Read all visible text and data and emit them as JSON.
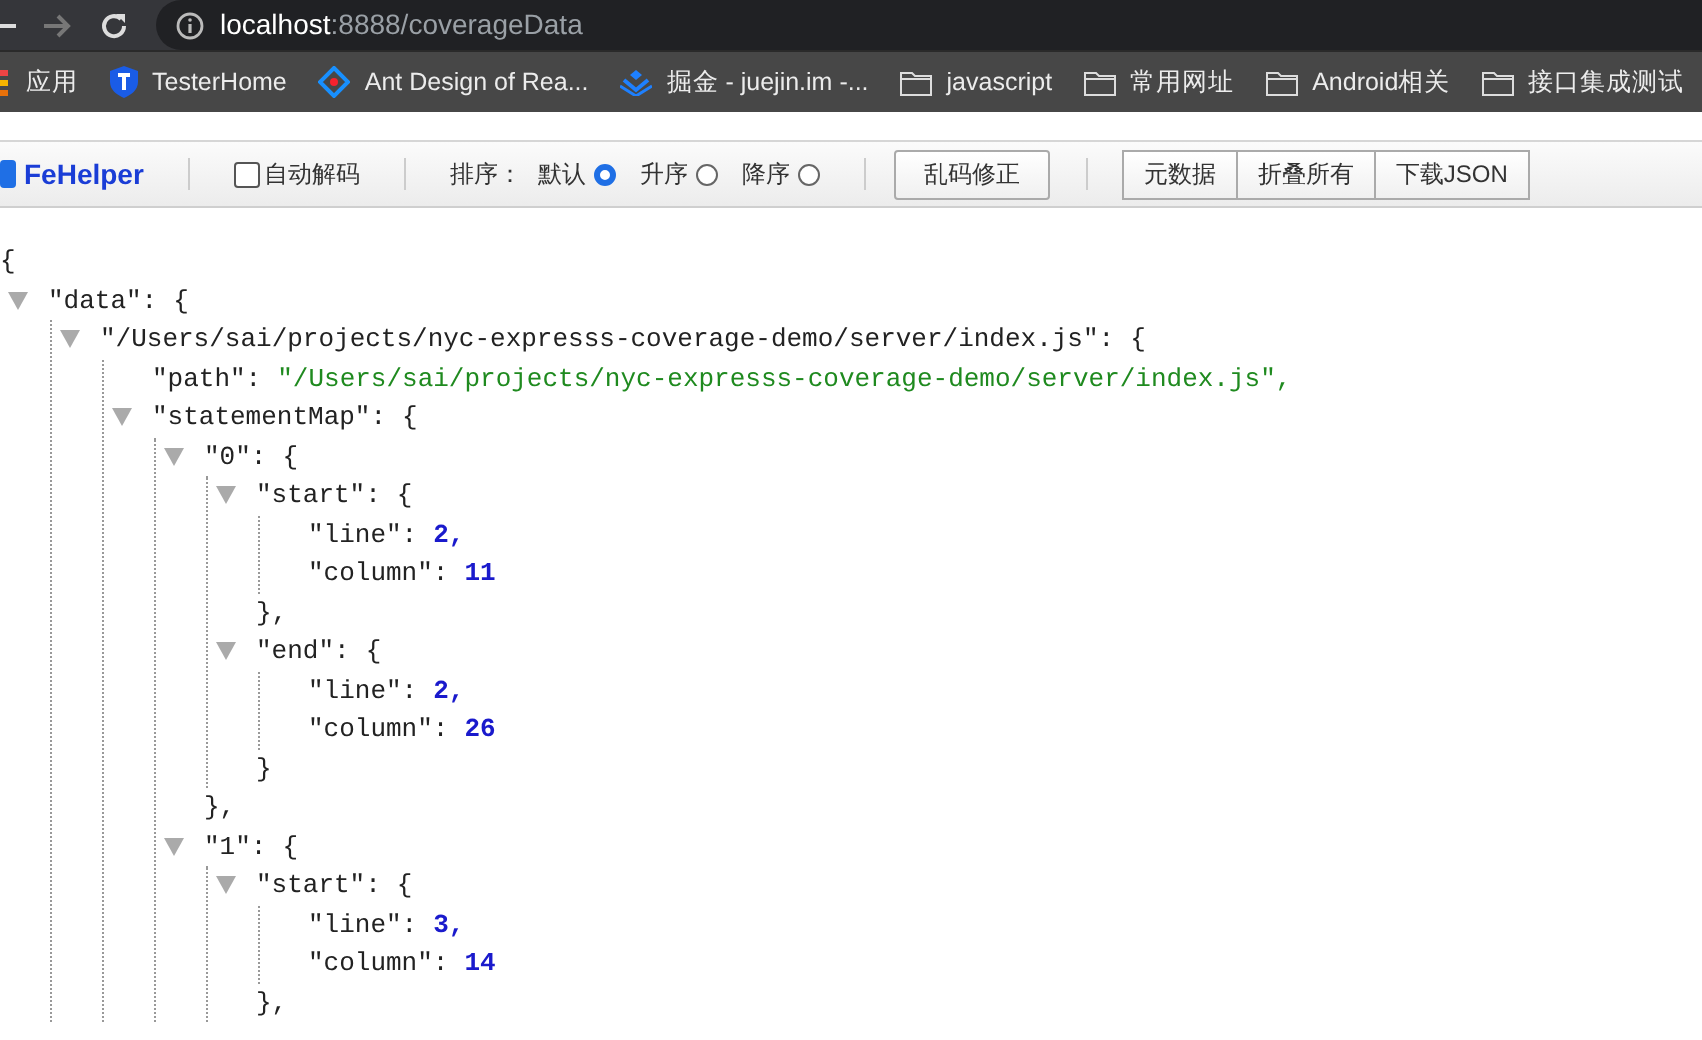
{
  "address_bar": {
    "host": "localhost",
    "path": ":8888/coverageData"
  },
  "bookmarks": [
    {
      "kind": "apps",
      "label": "应用"
    },
    {
      "kind": "shield",
      "label": "TesterHome"
    },
    {
      "kind": "diamond",
      "label": "Ant Design of Rea..."
    },
    {
      "kind": "chevrons",
      "label": "掘金 - juejin.im -..."
    },
    {
      "kind": "folder",
      "label": "javascript"
    },
    {
      "kind": "folder",
      "label": "常用网址"
    },
    {
      "kind": "folder",
      "label": "Android相关"
    },
    {
      "kind": "folder",
      "label": "接口集成测试"
    }
  ],
  "toolbar": {
    "brand": "FeHelper",
    "auto_decode": {
      "label": "自动解码",
      "checked": false
    },
    "sort_label": "排序：",
    "sort_options": [
      {
        "label": "默认",
        "selected": true
      },
      {
        "label": "升序",
        "selected": false
      },
      {
        "label": "降序",
        "selected": false
      }
    ],
    "fix_button": "乱码修正",
    "buttons": [
      "元数据",
      "折叠所有",
      "下载JSON"
    ]
  },
  "json_view": {
    "open": "{",
    "nodes": [
      {
        "kind": "object",
        "key": "\"data\":",
        "value": "{",
        "expanded": true,
        "children": [
          {
            "kind": "object",
            "key": "\"/Users/sai/projects/nyc-expresss-coverage-demo/server/index.js\":",
            "value": "{",
            "expanded": true,
            "children": [
              {
                "kind": "string",
                "key": "\"path\":",
                "value": "\"/Users/sai/projects/nyc-expresss-coverage-demo/server/index.js\","
              },
              {
                "kind": "object",
                "key": "\"statementMap\":",
                "value": "{",
                "expanded": true,
                "children": [
                  {
                    "kind": "object",
                    "key": "\"0\":",
                    "value": "{",
                    "expanded": true,
                    "close": "},",
                    "children": [
                      {
                        "kind": "object",
                        "key": "\"start\":",
                        "value": "{",
                        "expanded": true,
                        "close": "},",
                        "children": [
                          {
                            "kind": "number",
                            "key": "\"line\":",
                            "value": "2,"
                          },
                          {
                            "kind": "number",
                            "key": "\"column\":",
                            "value": "11"
                          }
                        ]
                      },
                      {
                        "kind": "object",
                        "key": "\"end\":",
                        "value": "{",
                        "expanded": true,
                        "close": "}",
                        "children": [
                          {
                            "kind": "number",
                            "key": "\"line\":",
                            "value": "2,"
                          },
                          {
                            "kind": "number",
                            "key": "\"column\":",
                            "value": "26"
                          }
                        ]
                      }
                    ]
                  },
                  {
                    "kind": "object",
                    "key": "\"1\":",
                    "value": "{",
                    "expanded": true,
                    "children": [
                      {
                        "kind": "object",
                        "key": "\"start\":",
                        "value": "{",
                        "expanded": true,
                        "close": "},",
                        "children": [
                          {
                            "kind": "number",
                            "key": "\"line\":",
                            "value": "3,"
                          },
                          {
                            "kind": "number",
                            "key": "\"column\":",
                            "value": "14"
                          }
                        ]
                      }
                    ]
                  }
                ]
              }
            ]
          }
        ]
      }
    ]
  }
}
